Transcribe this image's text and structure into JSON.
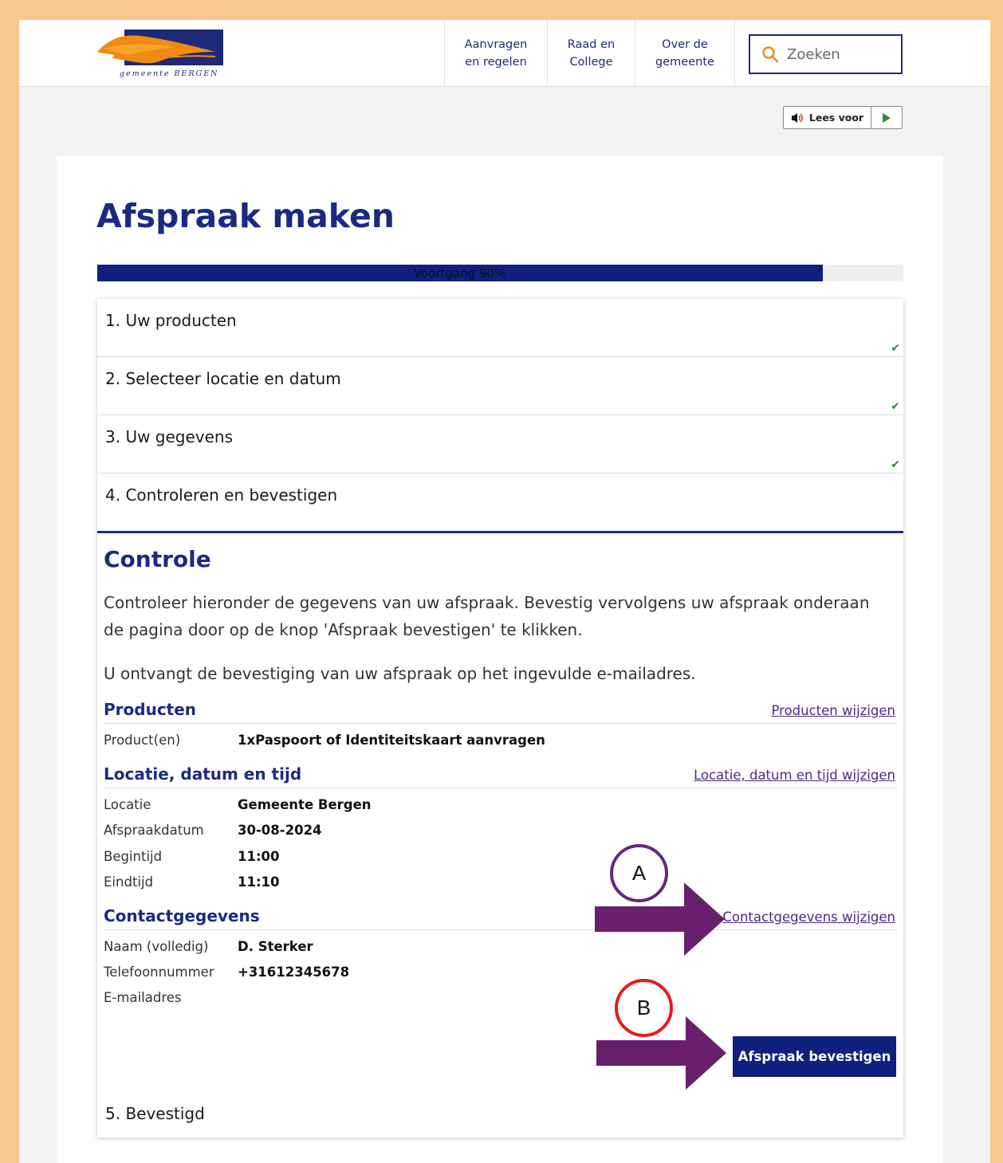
{
  "header": {
    "logo_text": "gemeente BERGEN",
    "nav": [
      {
        "line1": "Aanvragen",
        "line2": "en regelen"
      },
      {
        "line1": "Raad en",
        "line2": "College"
      },
      {
        "line1": "Over de",
        "line2": "gemeente"
      }
    ],
    "search_placeholder": "Zoeken",
    "read_aloud_label": "Lees voor"
  },
  "page": {
    "title": "Afspraak maken",
    "progress_label": "Voortgang 90%",
    "progress_value": 0.9
  },
  "steps": [
    {
      "label": "1. Uw producten",
      "completed": true
    },
    {
      "label": "2. Selecteer locatie en datum",
      "completed": true
    },
    {
      "label": "3. Uw gegevens",
      "completed": true
    },
    {
      "label": "4. Controleren en bevestigen",
      "completed": false
    },
    {
      "label": "5. Bevestigd",
      "completed": false
    }
  ],
  "controle": {
    "heading": "Controle",
    "intro": "Controleer hieronder de gegevens van uw afspraak. Bevestig vervolgens uw afspraak onderaan de pagina door op de knop 'Afspraak bevestigen' te klikken.",
    "email_note": "U ontvangt de bevestiging van uw afspraak op het ingevulde e-mailadres.",
    "products": {
      "title": "Producten",
      "edit_link": "Producten wijzigen",
      "rows": [
        {
          "label": "Product(en)",
          "value": "1xPaspoort of Identiteitskaart aanvragen"
        }
      ]
    },
    "location": {
      "title": "Locatie, datum en tijd",
      "edit_link": "Locatie, datum en tijd wijzigen",
      "rows": [
        {
          "label": "Locatie",
          "value": "Gemeente Bergen"
        },
        {
          "label": "Afspraakdatum",
          "value": "30-08-2024"
        },
        {
          "label": "Begintijd",
          "value": "11:00"
        },
        {
          "label": "Eindtijd",
          "value": "11:10"
        }
      ]
    },
    "contact": {
      "title": "Contactgegevens",
      "edit_link": "Contactgegevens wijzigen",
      "rows": [
        {
          "label": "Naam (volledig)",
          "value": "D. Sterker"
        },
        {
          "label": "Telefoonnummer",
          "value": "+31612345678"
        },
        {
          "label": "E-mailadres",
          "value": ""
        }
      ]
    },
    "confirm_button": "Afspraak bevestigen"
  },
  "annotations": {
    "marker_a": "A",
    "marker_b": "B",
    "arrow_color": "#6a1f6e",
    "marker_a_color": "#5f2a80",
    "marker_b_color": "#e61b1b"
  },
  "colors": {
    "frame": "#f6c88e",
    "brand": "#1a2a84",
    "progress": "#10207f",
    "check": "#2f8a2f"
  }
}
